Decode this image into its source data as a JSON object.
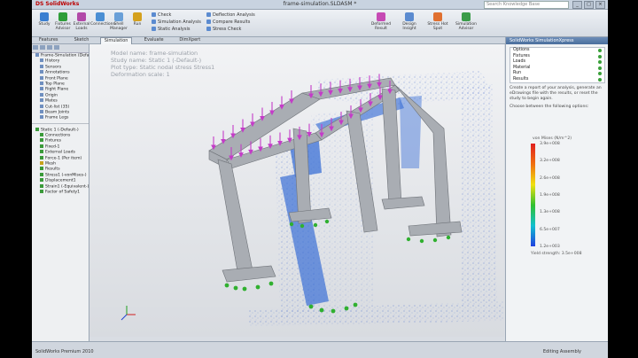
{
  "app": {
    "logo": "DS SolidWorks",
    "window_title": "frame-simulation.SLDASM *",
    "search_placeholder": "Search Knowledge Base"
  },
  "window_buttons": [
    "_",
    "□",
    "×"
  ],
  "ribbon": {
    "buttons": [
      {
        "label": "Study",
        "icon": "study-icon",
        "color": "#3b7fd1"
      },
      {
        "label": "Fixtures Advisor",
        "icon": "fixture-icon",
        "color": "#2f9e3a"
      },
      {
        "label": "External Loads",
        "icon": "load-icon",
        "color": "#b24aa8"
      },
      {
        "label": "Connections",
        "icon": "connection-icon",
        "color": "#4b8fd4"
      },
      {
        "label": "Shell Manager",
        "icon": "shell-icon",
        "color": "#6aa0d8"
      },
      {
        "label": "Run",
        "icon": "run-icon",
        "color": "#d4a11e"
      }
    ],
    "tool_rows": [
      "Check",
      "Simulation Analysis",
      "Static Analysis",
      "Deflection Analysis",
      "Compare Results",
      "Stress Check"
    ],
    "wide_buttons": [
      {
        "label": "Deformed Result",
        "color": "#c64ab4"
      },
      {
        "label": "Design Insight",
        "color": "#5b8bd0"
      },
      {
        "label": "Stress Hot Spot",
        "color": "#e07030"
      },
      {
        "label": "Simulation Advisor",
        "color": "#3b9c4a"
      }
    ]
  },
  "tabs": [
    "Features",
    "Sketch",
    "Simulation",
    "Evaluate",
    "DimXpert"
  ],
  "active_tab": "Simulation",
  "tree": {
    "top_items": [
      "Frame-Simulation (Default)",
      "History",
      "Sensors",
      "Annotations",
      "Front Plane",
      "Top Plane",
      "Right Plane",
      "Origin",
      "Mates",
      "Cut-list (35)",
      "Beam Joints",
      "Frame Legs"
    ],
    "sim_items": [
      "Static 1 (-Default-)",
      "Connections",
      "Fixtures",
      "Fixed-1",
      "External Loads",
      "Force-1 (Per item)",
      "Mesh",
      "Results",
      "Stress1 (-vonMises-)",
      "Displacement1",
      "Strain1 (-Equivalent-)",
      "Factor of Safety1"
    ]
  },
  "viewport": {
    "watermark_lines": [
      "Model name: frame-simulation",
      "Study name: Static 1 (-Default-)",
      "Plot type: Static nodal stress Stress1",
      "Deformation scale: 1"
    ]
  },
  "right_panel": {
    "header": "SolidWorks SimulationXpress",
    "steps": [
      "Options",
      "Fixtures",
      "Loads",
      "Material",
      "Run",
      "Results"
    ],
    "description": "Create a report of your analysis, generate an eDrawings file with the results, or reset the study to begin again.",
    "prompt": "Choose between the following options:",
    "legend_title": "von Mises (N/m^2)",
    "legend_values": [
      "3.9e+008",
      "3.2e+008",
      "2.6e+008",
      "1.9e+008",
      "1.3e+008",
      "6.5e+007",
      "1.2e+003"
    ],
    "yield_text": "Yield strength: 3.5e+008"
  },
  "status": {
    "left": "SolidWorks Premium 2010",
    "right": "Editing Assembly"
  },
  "colors": {
    "load_arrows": "#c43cc8",
    "fixtures": "#30b030",
    "frame": "#a9adb3",
    "stress_overlay": "#3a6fd6"
  }
}
